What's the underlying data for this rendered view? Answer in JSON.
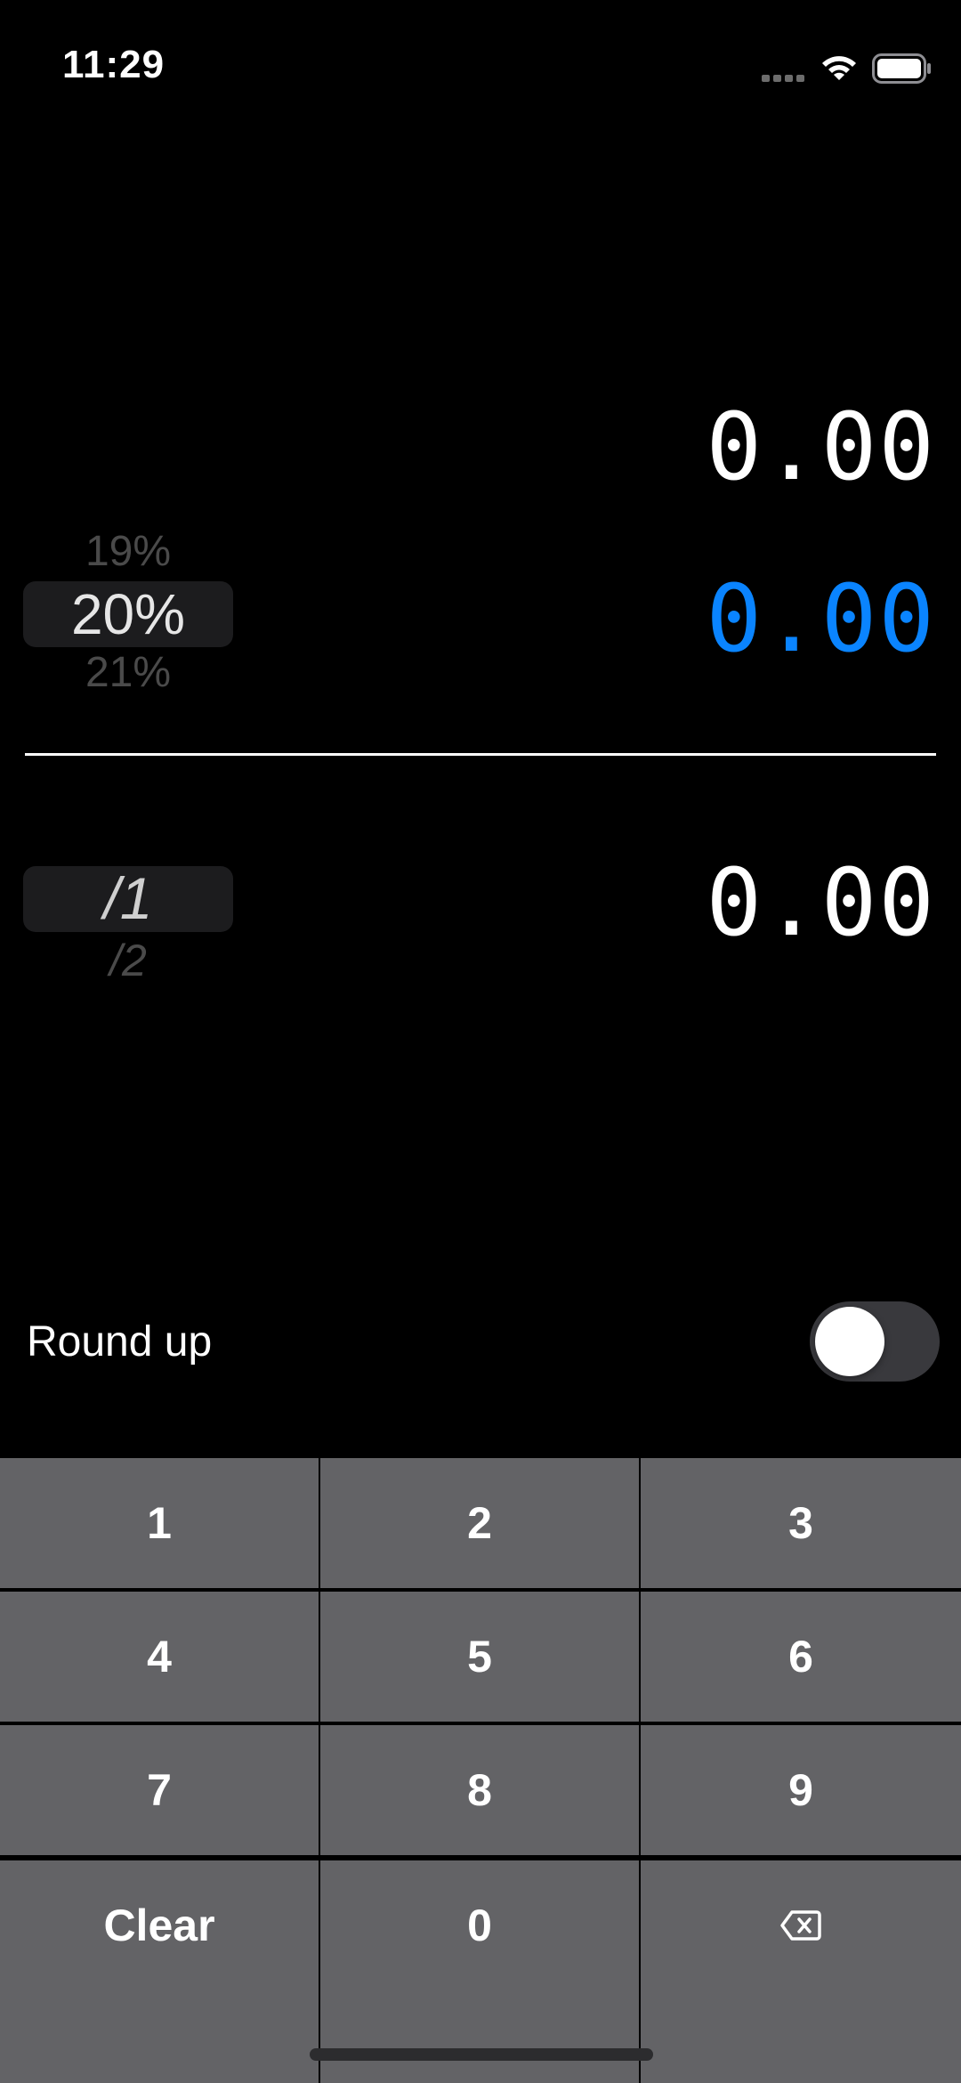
{
  "status_bar": {
    "time": "11:29",
    "icons": [
      "cellular-signal-icon",
      "wifi-icon",
      "battery-icon"
    ]
  },
  "amounts": {
    "bill": "0.00",
    "tip": "0.00",
    "total": "0.00"
  },
  "tip_picker": {
    "above": "19%",
    "selected": "20%",
    "below": "21%"
  },
  "split_picker": {
    "selected": "/1",
    "below": "/2"
  },
  "round_up": {
    "label": "Round up",
    "enabled": false
  },
  "keypad": {
    "keys": [
      [
        "1",
        "2",
        "3"
      ],
      [
        "4",
        "5",
        "6"
      ],
      [
        "7",
        "8",
        "9"
      ],
      [
        "Clear",
        "0",
        "delete-backward-icon"
      ]
    ]
  },
  "colors": {
    "background": "#000000",
    "accent": "#0a84ff",
    "key_background": "#636366",
    "toggle_off": "#39393d"
  }
}
